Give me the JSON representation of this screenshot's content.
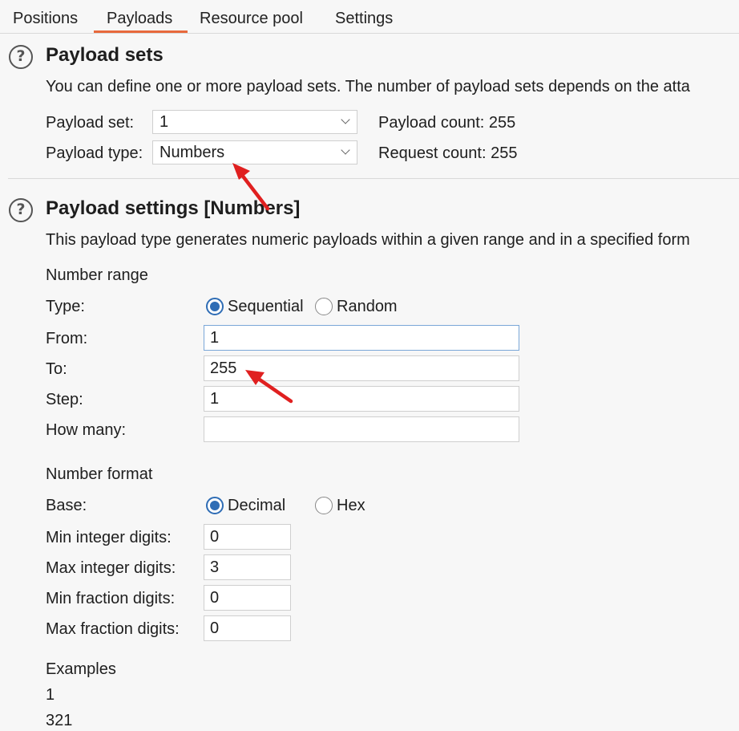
{
  "colors": {
    "tab_accent": "#e8693c",
    "radio_accent": "#2f6db5",
    "annotation_arrow": "#e02020"
  },
  "tabs": [
    {
      "label": "Positions"
    },
    {
      "label": "Payloads",
      "active": true
    },
    {
      "label": "Resource pool"
    },
    {
      "label": "Settings"
    }
  ],
  "payload_sets": {
    "help_glyph": "?",
    "title": "Payload sets",
    "description": "You can define one or more payload sets. The number of payload sets depends on the atta",
    "set_label": "Payload set:",
    "set_value": "1",
    "type_label": "Payload type:",
    "type_value": "Numbers",
    "payload_count": "Payload count: 255",
    "request_count": "Request count: 255"
  },
  "payload_settings": {
    "help_glyph": "?",
    "title": "Payload settings [Numbers]",
    "description": "This payload type generates numeric payloads within a given range and in a specified form",
    "number_range": {
      "heading": "Number range",
      "type_label": "Type:",
      "options": [
        {
          "label": "Sequential",
          "selected": true
        },
        {
          "label": "Random",
          "selected": false
        }
      ],
      "from_label": "From:",
      "from_value": "1",
      "to_label": "To:",
      "to_value": "255",
      "step_label": "Step:",
      "step_value": "1",
      "how_many_label": "How many:",
      "how_many_value": ""
    },
    "number_format": {
      "heading": "Number format",
      "base_label": "Base:",
      "options": [
        {
          "label": "Decimal",
          "selected": true
        },
        {
          "label": "Hex",
          "selected": false
        }
      ],
      "min_int_label": "Min integer digits:",
      "min_int_value": "0",
      "max_int_label": "Max integer digits:",
      "max_int_value": "3",
      "min_frac_label": "Min fraction digits:",
      "min_frac_value": "0",
      "max_frac_label": "Max fraction digits:",
      "max_frac_value": "0"
    },
    "examples": {
      "heading": "Examples",
      "items": [
        "1",
        "321"
      ]
    }
  }
}
